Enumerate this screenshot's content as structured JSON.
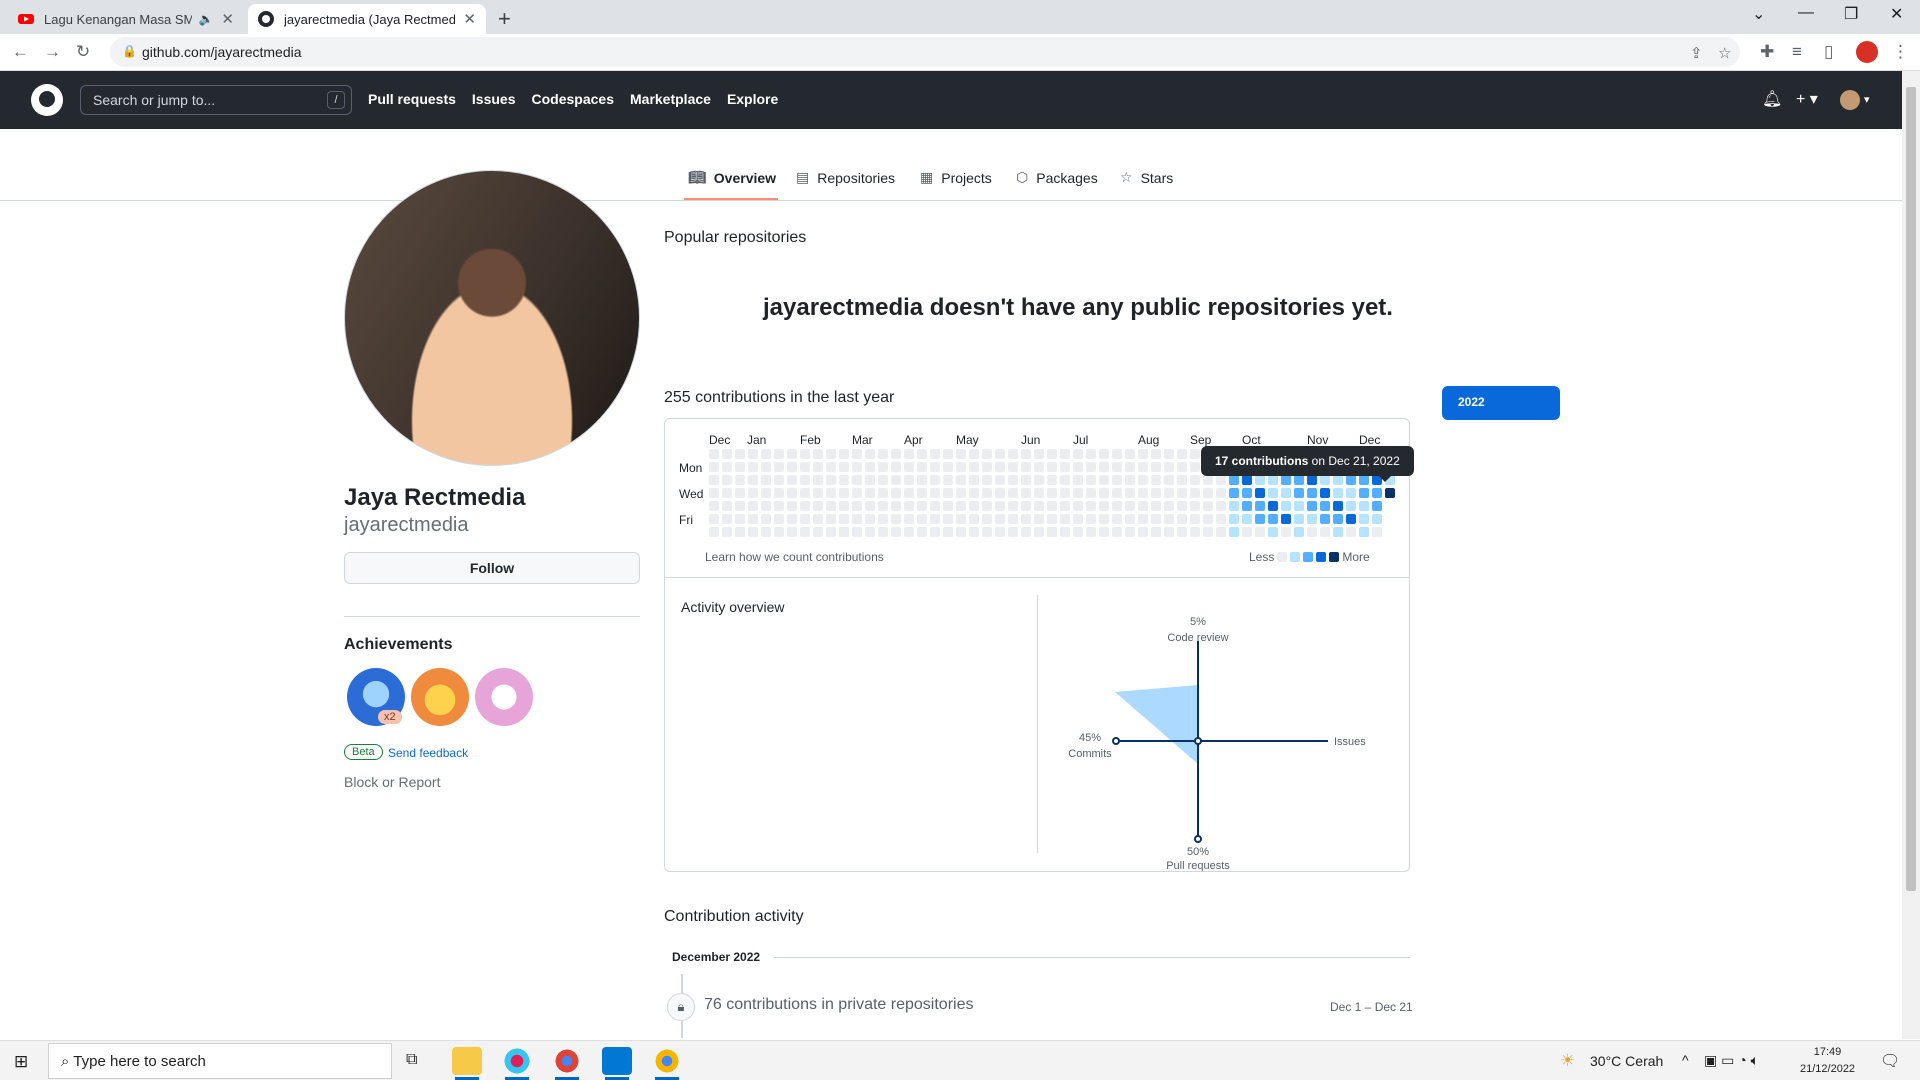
{
  "browser": {
    "tabs": [
      {
        "title": "Lagu Kenangan Masa SMA -",
        "active": false
      },
      {
        "title": "jayarectmedia (Jaya Rectmedia)",
        "active": true
      }
    ],
    "url": "github.com/jayarectmedia"
  },
  "github": {
    "search_placeholder": "Search or jump to...",
    "search_key": "/",
    "nav": [
      "Pull requests",
      "Issues",
      "Codespaces",
      "Marketplace",
      "Explore"
    ]
  },
  "profile_tabs": [
    {
      "label": "Overview",
      "icon": "book-icon",
      "selected": true
    },
    {
      "label": "Repositories",
      "icon": "repo-icon",
      "selected": false
    },
    {
      "label": "Projects",
      "icon": "table-icon",
      "selected": false
    },
    {
      "label": "Packages",
      "icon": "package-icon",
      "selected": false
    },
    {
      "label": "Stars",
      "icon": "star-icon",
      "selected": false
    }
  ],
  "profile": {
    "name": "Jaya Rectmedia",
    "login": "jayarectmedia",
    "follow_label": "Follow",
    "achievements_title": "Achievements",
    "achievement_multiplier": "x2",
    "beta_label": "Beta",
    "feedback_label": "Send feedback",
    "block_label": "Block or Report"
  },
  "main": {
    "popular_title": "Popular repositories",
    "no_repos": "jayarectmedia doesn't have any public repositories yet.",
    "contrib_title": "255 contributions in the last year",
    "year": "2022",
    "months": [
      "Dec",
      "Jan",
      "Feb",
      "Mar",
      "Apr",
      "May",
      "Jun",
      "Jul",
      "Aug",
      "Sep",
      "Oct",
      "Nov",
      "Dec"
    ],
    "days": [
      "Mon",
      "Wed",
      "Fri"
    ],
    "learn_link": "Learn how we count contributions",
    "legend_less": "Less",
    "legend_more": "More",
    "tooltip_bold": "17 contributions",
    "tooltip_rest": " on Dec 21, 2022",
    "activity_title": "Activity overview",
    "radar": {
      "code_review_pct": "5%",
      "code_review": "Code review",
      "commits_pct": "45%",
      "commits": "Commits",
      "issues": "Issues",
      "pr_pct": "50%",
      "pr": "Pull requests"
    },
    "contribution_activity_title": "Contribution activity",
    "month_heading": "December 2022",
    "private_text": "76 contributions in private repositories",
    "date_range": "Dec 1 – Dec 21"
  },
  "colors": {
    "level0": "#ebedf0",
    "level1": "#9be9a8",
    "level_blue1": "#b6e3ff",
    "level_blue2": "#54aeff",
    "level_blue3": "#0969da",
    "level_blue4": "#0a3069",
    "accent": "#0969da"
  },
  "taskbar": {
    "search_placeholder": "Type here to search",
    "weather": "30°C  Cerah",
    "time": "17:49",
    "date": "21/12/2022"
  }
}
